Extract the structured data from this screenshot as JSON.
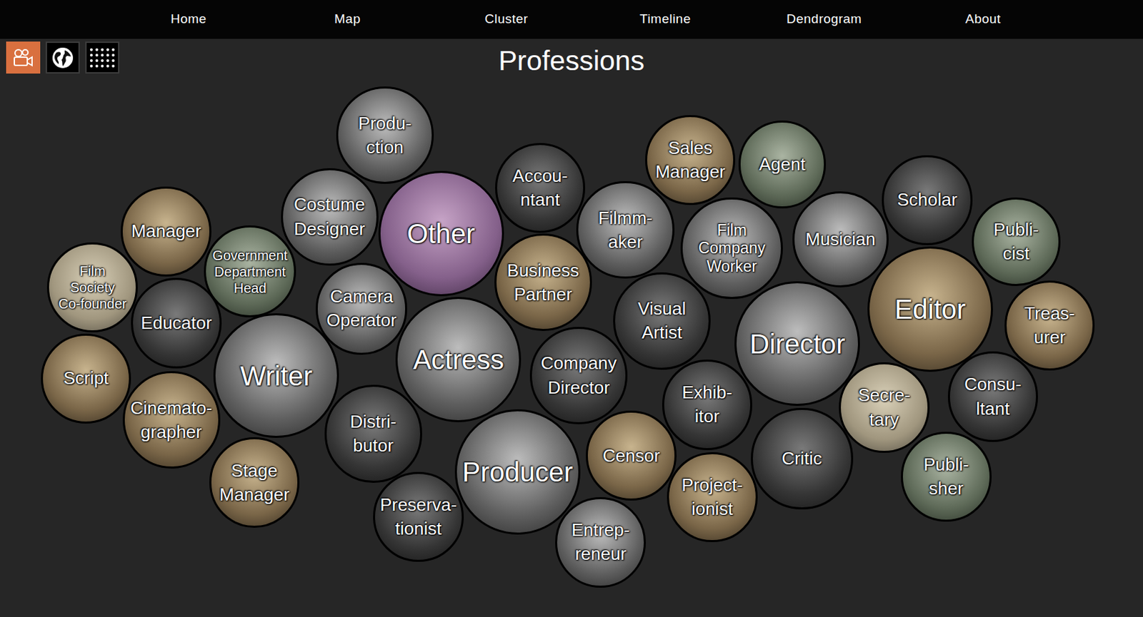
{
  "nav": [
    {
      "label": "Home"
    },
    {
      "label": "Map"
    },
    {
      "label": "Cluster"
    },
    {
      "label": "Timeline"
    },
    {
      "label": "Dendrogram"
    },
    {
      "label": "About"
    }
  ],
  "views": [
    {
      "kind": "film",
      "selected": true
    },
    {
      "kind": "globe",
      "selected": false
    },
    {
      "kind": "grid",
      "selected": false
    }
  ],
  "title": "Professions",
  "bubbles": [
    {
      "lines": [
        "Produ-",
        "ction"
      ],
      "highlighted": false
    },
    {
      "lines": [
        "Accou-",
        "ntant"
      ],
      "highlighted": false
    },
    {
      "lines": [
        "Sales",
        "Manager"
      ],
      "highlighted": false
    },
    {
      "lines": [
        "Agent"
      ],
      "highlighted": false
    },
    {
      "lines": [
        "Scholar"
      ],
      "highlighted": false
    },
    {
      "lines": [
        "Publi-",
        "cist"
      ],
      "highlighted": false
    },
    {
      "lines": [
        "Manager"
      ],
      "highlighted": false
    },
    {
      "lines": [
        "Costume",
        "Designer"
      ],
      "highlighted": false
    },
    {
      "lines": [
        "Other"
      ],
      "highlighted": true
    },
    {
      "lines": [
        "Filmm-",
        "aker"
      ],
      "highlighted": false
    },
    {
      "lines": [
        "Film",
        "Company",
        "Worker"
      ],
      "highlighted": false
    },
    {
      "lines": [
        "Musician"
      ],
      "highlighted": false
    },
    {
      "lines": [
        "Film",
        "Society",
        "Co-founder"
      ],
      "highlighted": false
    },
    {
      "lines": [
        "Government",
        "Department",
        "Head"
      ],
      "highlighted": false
    },
    {
      "lines": [
        "Business",
        "Partner"
      ],
      "highlighted": false
    },
    {
      "lines": [
        "Editor"
      ],
      "highlighted": false
    },
    {
      "lines": [
        "Treas-",
        "urer"
      ],
      "highlighted": false
    },
    {
      "lines": [
        "Educator"
      ],
      "highlighted": false
    },
    {
      "lines": [
        "Camera",
        "Operator"
      ],
      "highlighted": false
    },
    {
      "lines": [
        "Visual",
        "Artist"
      ],
      "highlighted": false
    },
    {
      "lines": [
        "Director"
      ],
      "highlighted": false
    },
    {
      "lines": [
        "Actress"
      ],
      "highlighted": false
    },
    {
      "lines": [
        "Company",
        "Director"
      ],
      "highlighted": false
    },
    {
      "lines": [
        "Script"
      ],
      "highlighted": false
    },
    {
      "lines": [
        "Writer"
      ],
      "highlighted": false
    },
    {
      "lines": [
        "Secre-",
        "tary"
      ],
      "highlighted": false
    },
    {
      "lines": [
        "Consu-",
        "ltant"
      ],
      "highlighted": false
    },
    {
      "lines": [
        "Exhib-",
        "itor"
      ],
      "highlighted": false
    },
    {
      "lines": [
        "Cinemato-",
        "grapher"
      ],
      "highlighted": false
    },
    {
      "lines": [
        "Distri-",
        "butor"
      ],
      "highlighted": false
    },
    {
      "lines": [
        "Critic"
      ],
      "highlighted": false
    },
    {
      "lines": [
        "Censor"
      ],
      "highlighted": false
    },
    {
      "lines": [
        "Producer"
      ],
      "highlighted": false
    },
    {
      "lines": [
        "Publi-",
        "sher"
      ],
      "highlighted": false
    },
    {
      "lines": [
        "Stage",
        "Manager"
      ],
      "highlighted": false
    },
    {
      "lines": [
        "Project-",
        "ionist"
      ],
      "highlighted": false
    },
    {
      "lines": [
        "Preserva-",
        "tionist"
      ],
      "highlighted": false
    },
    {
      "lines": [
        "Entrep-",
        "reneur"
      ],
      "highlighted": false
    }
  ]
}
